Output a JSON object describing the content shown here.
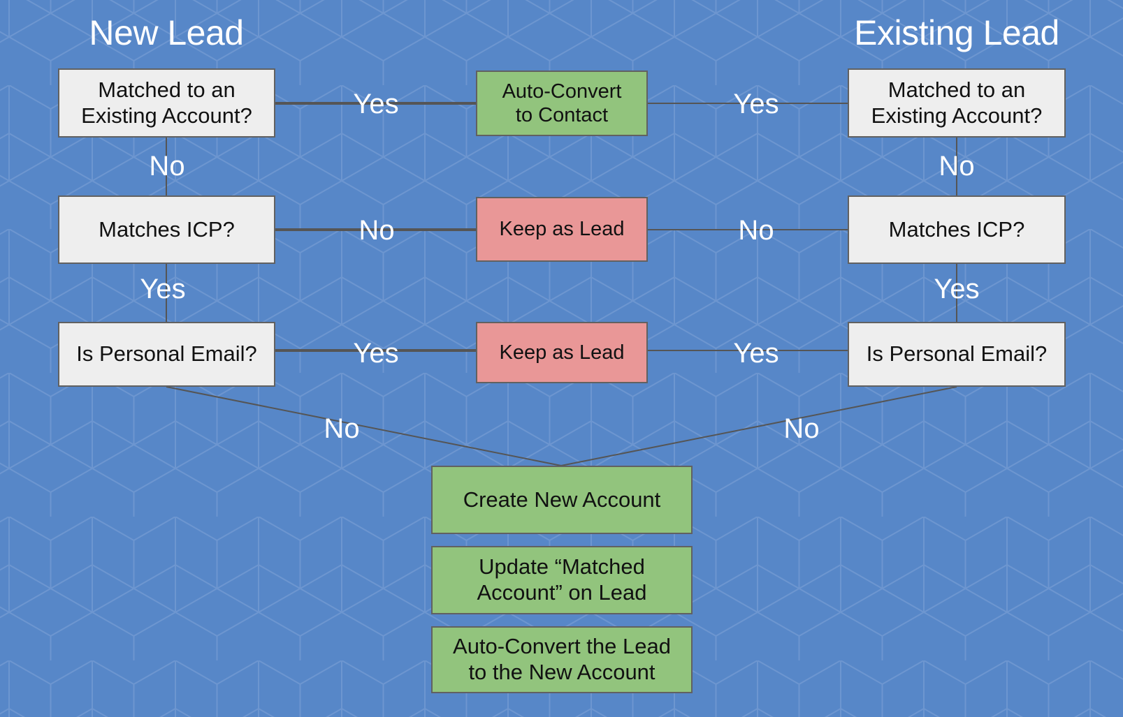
{
  "colors": {
    "background": "#5787c8",
    "pattern_line": "#7199d1",
    "decision_fill": "#eeeeee",
    "success_fill": "#92c47d",
    "keep_fill": "#e99797",
    "border": "#616161",
    "connector": "#555555",
    "label_text": "#ffffff"
  },
  "headers": {
    "new_lead": "New Lead",
    "existing_lead": "Existing Lead"
  },
  "new_lead": {
    "matched": "Matched to an\nExisting Account?",
    "icp": "Matches ICP?",
    "email": "Is Personal Email?"
  },
  "existing_lead": {
    "matched": "Matched to an\nExisting Account?",
    "icp": "Matches ICP?",
    "email": "Is Personal Email?"
  },
  "outcomes": {
    "auto_convert_contact": "Auto-Convert\nto Contact",
    "keep_as_lead_icp": "Keep as Lead",
    "keep_as_lead_email": "Keep as Lead",
    "create_account": "Create  New Account",
    "update_matched": "Update “Matched\nAccount” on Lead",
    "auto_convert_new": "Auto-Convert the Lead\nto the New Account"
  },
  "edge_labels": {
    "new_matched_yes": "Yes",
    "new_matched_no": "No",
    "new_icp_no": "No",
    "new_icp_yes": "Yes",
    "new_email_yes": "Yes",
    "new_email_no": "No",
    "existing_matched_yes": "Yes",
    "existing_matched_no": "No",
    "existing_icp_no": "No",
    "existing_icp_yes": "Yes",
    "existing_email_yes": "Yes",
    "existing_email_no": "No"
  }
}
